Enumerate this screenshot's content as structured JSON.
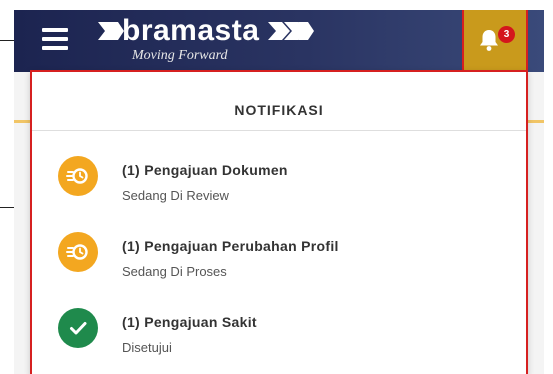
{
  "header": {
    "brand_name": "bramasta",
    "tagline": "Moving Forward",
    "notification_count": "3",
    "colors": {
      "topbar": "#1c2450",
      "bell_bg": "#c99a1c",
      "badge": "#d4161c"
    }
  },
  "notifications": {
    "title": "NOTIFIKASI",
    "items": [
      {
        "title": "(1) Pengajuan Dokumen",
        "status": "Sedang Di Review",
        "icon": "pending-clock-icon",
        "color": "#f3a720"
      },
      {
        "title": "(1) Pengajuan Perubahan Profil",
        "status": "Sedang Di Proses",
        "icon": "pending-clock-icon",
        "color": "#f3a720"
      },
      {
        "title": "(1) Pengajuan Sakit",
        "status": "Disetujui",
        "icon": "check-icon",
        "color": "#1f8a4c"
      }
    ]
  }
}
